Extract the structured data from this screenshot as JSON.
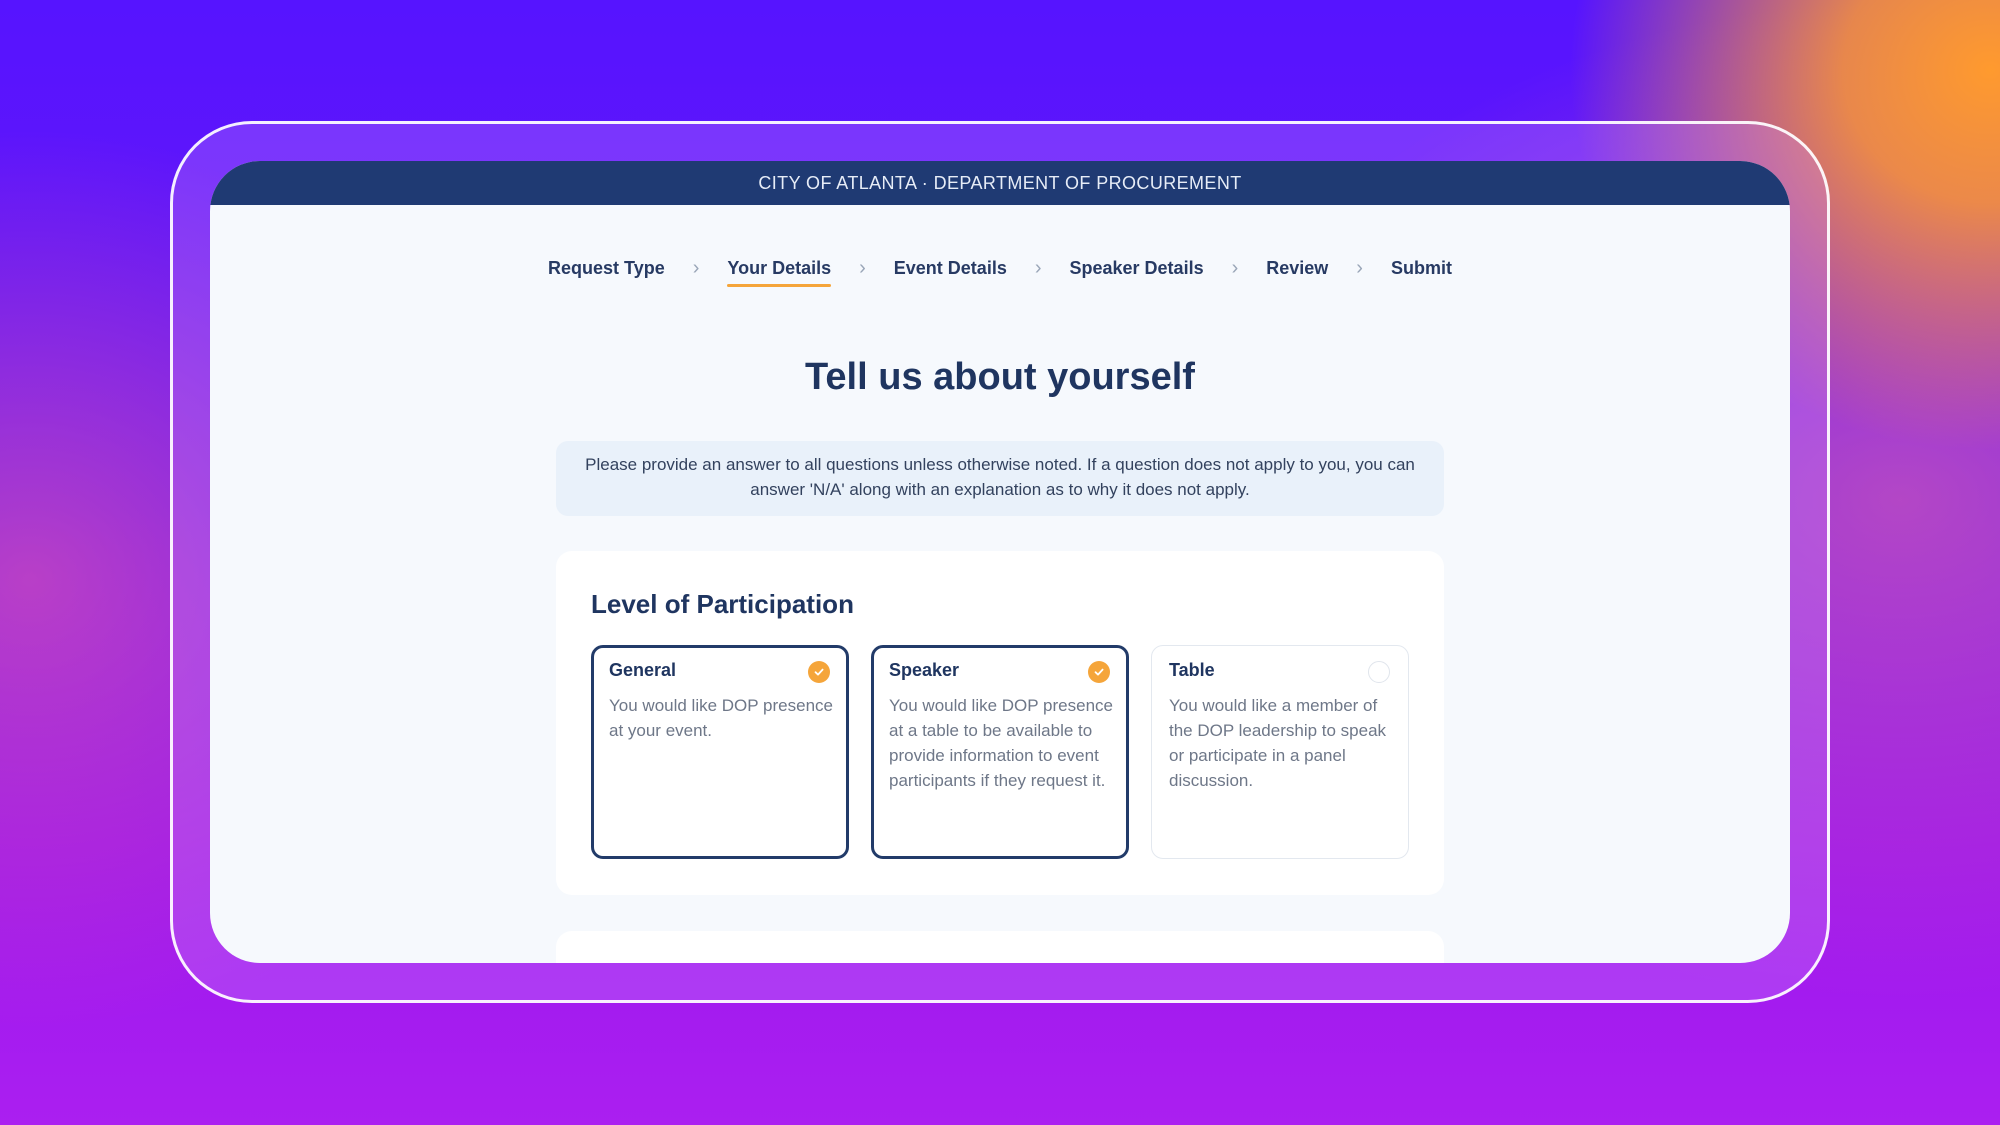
{
  "header": {
    "title": "CITY OF ATLANTA · DEPARTMENT OF PROCUREMENT"
  },
  "steps": [
    {
      "label": "Request Type",
      "active": false
    },
    {
      "label": "Your Details",
      "active": true
    },
    {
      "label": "Event Details",
      "active": false
    },
    {
      "label": "Speaker Details",
      "active": false
    },
    {
      "label": "Review",
      "active": false
    },
    {
      "label": "Submit",
      "active": false
    }
  ],
  "page": {
    "title": "Tell us about yourself",
    "notice": "Please provide an answer to all questions unless otherwise noted. If a question does not apply to you, you can answer 'N/A' along with an explanation as to why it does not apply."
  },
  "participation": {
    "title": "Level of Participation",
    "options": [
      {
        "label": "General",
        "description": "You would like DOP presence at your event.",
        "selected": true
      },
      {
        "label": "Speaker",
        "description": "You would like DOP presence at a table to be available to provide information to event participants if they request it.",
        "selected": true
      },
      {
        "label": "Table",
        "description": "You would like a member of the DOP leadership to speak or participate in a panel discussion.",
        "selected": false
      }
    ]
  },
  "colors": {
    "header_bg": "#1f3a73",
    "accent": "#f5a53a",
    "selected_border": "#223b69",
    "heading": "#1f3560"
  },
  "icons": {
    "step_separator": "chevron-right-icon",
    "selected_marker": "check-circle-icon"
  }
}
